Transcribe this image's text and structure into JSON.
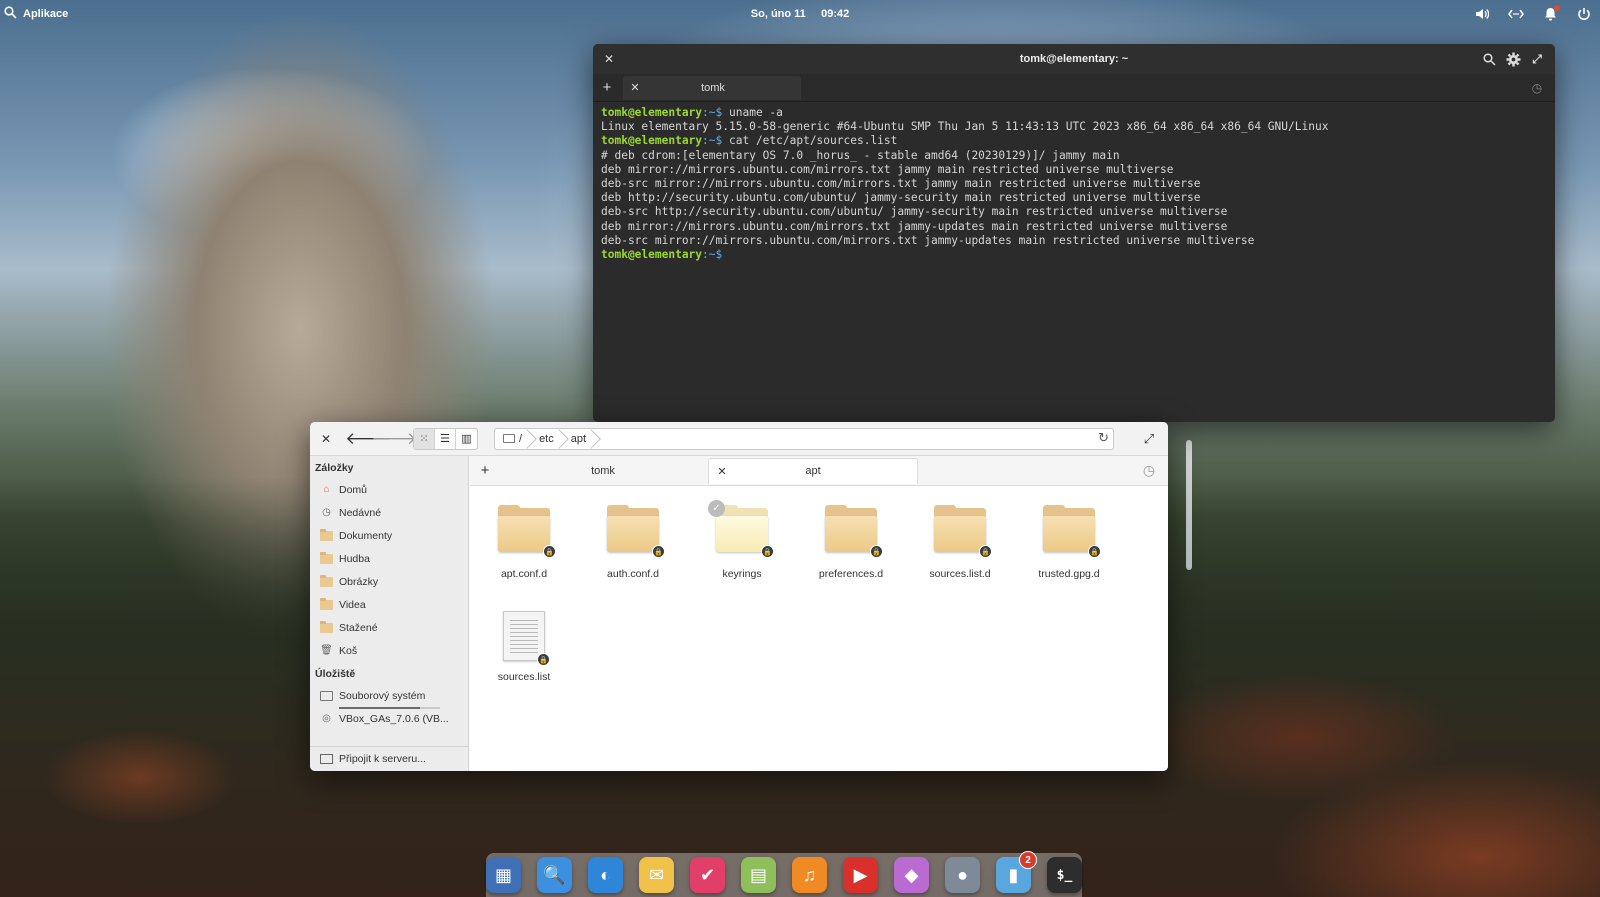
{
  "panel": {
    "apps_label": "Aplikace",
    "date": "So, úno 11",
    "time": "09:42",
    "indicators": [
      "volume-icon",
      "network-icon",
      "notifications-icon",
      "power-icon"
    ]
  },
  "terminal": {
    "title": "tomk@elementary: ~",
    "tab_label": "tomk",
    "lines": [
      {
        "prompt": "tomk@elementary",
        "dir": ":~$",
        "cmd": " uname -a"
      },
      {
        "text": "Linux elementary 5.15.0-58-generic #64-Ubuntu SMP Thu Jan 5 11:43:13 UTC 2023 x86_64 x86_64 x86_64 GNU/Linux"
      },
      {
        "prompt": "tomk@elementary",
        "dir": ":~$",
        "cmd": " cat /etc/apt/sources.list"
      },
      {
        "text": "# deb cdrom:[elementary OS 7.0 _horus_ - stable amd64 (20230129)]/ jammy main"
      },
      {
        "text": "deb mirror://mirrors.ubuntu.com/mirrors.txt jammy main restricted universe multiverse"
      },
      {
        "text": "deb-src mirror://mirrors.ubuntu.com/mirrors.txt jammy main restricted universe multiverse"
      },
      {
        "text": "deb http://security.ubuntu.com/ubuntu/ jammy-security main restricted universe multiverse"
      },
      {
        "text": "deb-src http://security.ubuntu.com/ubuntu/ jammy-security main restricted universe multiverse"
      },
      {
        "text": "deb mirror://mirrors.ubuntu.com/mirrors.txt jammy-updates main restricted universe multiverse"
      },
      {
        "text": "deb-src mirror://mirrors.ubuntu.com/mirrors.txt jammy-updates main restricted universe multiverse"
      },
      {
        "prompt": "tomk@elementary",
        "dir": ":~$",
        "cmd": ""
      }
    ]
  },
  "files": {
    "path": [
      "/",
      "etc",
      "apt"
    ],
    "tabs": [
      {
        "label": "tomk"
      },
      {
        "label": "apt"
      }
    ],
    "sidebar": {
      "bookmarks_heading": "Záložky",
      "bookmarks": [
        "Domů",
        "Nedávné",
        "Dokumenty",
        "Hudba",
        "Obrázky",
        "Videa",
        "Stažené",
        "Koš"
      ],
      "storage_heading": "Úložiště",
      "storage": [
        "Souborový systém",
        "VBox_GAs_7.0.6 (VB..."
      ],
      "filesystem_usage_fraction": 0.8,
      "connect_label": "Připojit k serveru..."
    },
    "items": [
      {
        "name": "apt.conf.d",
        "kind": "folder"
      },
      {
        "name": "auth.conf.d",
        "kind": "folder"
      },
      {
        "name": "keyrings",
        "kind": "folder-selected"
      },
      {
        "name": "preferences.d",
        "kind": "folder"
      },
      {
        "name": "sources.list.d",
        "kind": "folder"
      },
      {
        "name": "trusted.gpg.d",
        "kind": "folder"
      },
      {
        "name": "sources.list",
        "kind": "file"
      }
    ]
  },
  "dock": {
    "apps": [
      {
        "name": "multitasking-view",
        "glyph": "▦",
        "color": "#3f6fb5"
      },
      {
        "name": "files",
        "glyph": "🔍",
        "color": "#3d8fe0"
      },
      {
        "name": "web-browser",
        "glyph": "◐",
        "color": "#2f86d8"
      },
      {
        "name": "mail",
        "glyph": "✉",
        "color": "#f0c24a"
      },
      {
        "name": "tasks",
        "glyph": "✔",
        "color": "#e23e6a"
      },
      {
        "name": "calendar",
        "glyph": "▤",
        "color": "#8fbf5a"
      },
      {
        "name": "music",
        "glyph": "♫",
        "color": "#f08a24"
      },
      {
        "name": "videos",
        "glyph": "▶",
        "color": "#d9302b"
      },
      {
        "name": "photos",
        "glyph": "◆",
        "color": "#b96bd1"
      },
      {
        "name": "system-settings",
        "glyph": "●",
        "color": "#7f8a99"
      },
      {
        "name": "appcenter",
        "glyph": "▮",
        "color": "#5aa7e0",
        "badge": "2"
      },
      {
        "name": "terminal",
        "glyph": "$_",
        "color": "#2d2d2d"
      }
    ]
  }
}
